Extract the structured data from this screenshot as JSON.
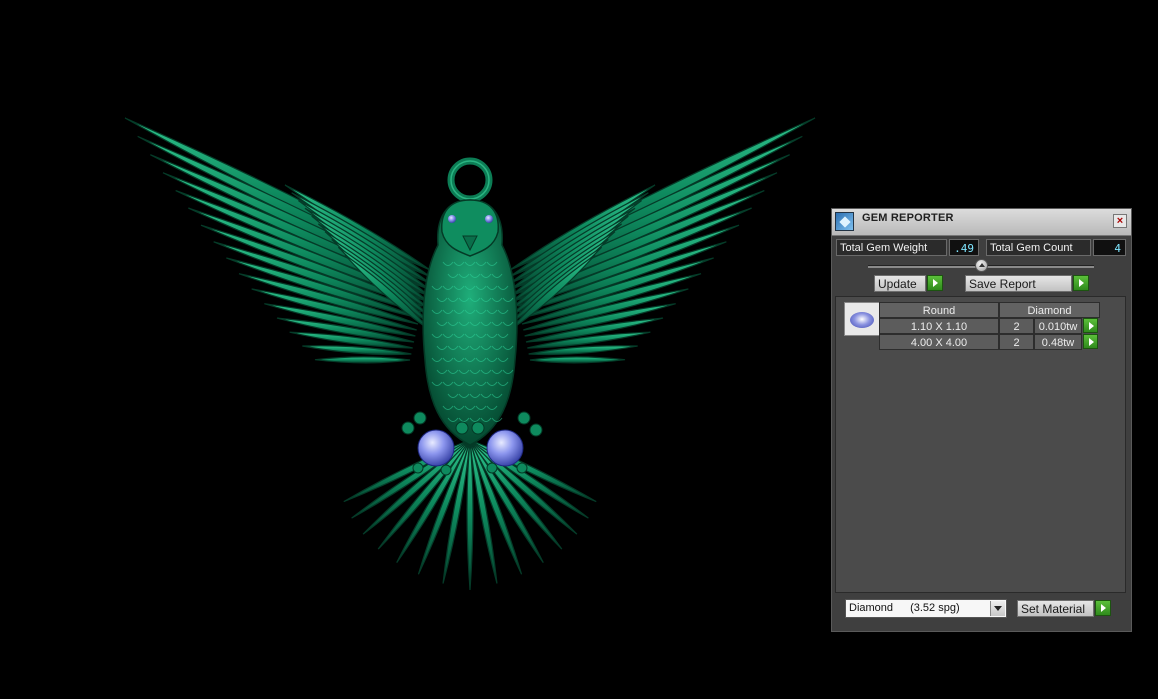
{
  "panel": {
    "title": "GEM REPORTER",
    "close_glyph": "×",
    "total_weight_label": "Total Gem Weight",
    "total_weight_value": ".49",
    "total_count_label": "Total Gem Count",
    "total_count_value": "4",
    "update_label": "Update",
    "save_report_label": "Save Report",
    "gem": {
      "shape": "Round",
      "material": "Diamond",
      "rows": [
        {
          "size": "1.10 X 1.10",
          "count": "2",
          "weight": "0.010tw"
        },
        {
          "size": "4.00 X 4.00",
          "count": "2",
          "weight": "0.48tw"
        }
      ]
    },
    "material_select": {
      "name": "Diamond",
      "density": "(3.52 spg)"
    },
    "set_material_label": "Set Material"
  },
  "colors": {
    "model_green": "#0d8a5f",
    "gem_blue": "#7b86e8",
    "accent_value": "#7fe6ff",
    "go_button": "#3ea326"
  },
  "icons": [
    "gem-reporter-app-icon",
    "close-icon",
    "slider-thumb-icon",
    "go-arrow-icon",
    "round-diamond-icon",
    "dropdown-arrow-icon"
  ]
}
